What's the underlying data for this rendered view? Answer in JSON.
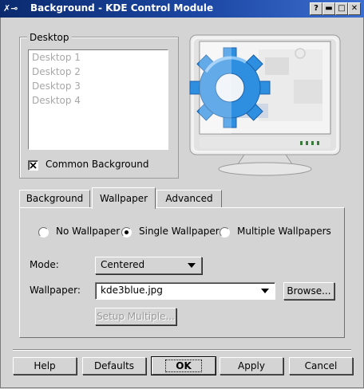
{
  "window": {
    "title": "Background - KDE Control Module",
    "icon_text": "✗⊸",
    "buttons": {
      "help": "?",
      "minimize": "▬",
      "maximize": "□",
      "close": "✕"
    }
  },
  "desktop": {
    "legend": "Desktop",
    "items": [
      "Desktop 1",
      "Desktop 2",
      "Desktop 3",
      "Desktop 4"
    ],
    "common_background": {
      "label": "Common Background",
      "checked": true
    }
  },
  "tabs": [
    {
      "label": "Background"
    },
    {
      "label": "Wallpaper",
      "active": true
    },
    {
      "label": "Advanced"
    }
  ],
  "wallpaper_tab": {
    "options": [
      {
        "label": "No Wallpaper",
        "selected": false
      },
      {
        "label": "Single Wallpaper",
        "selected": true
      },
      {
        "label": "Multiple Wallpapers",
        "selected": false
      }
    ],
    "mode": {
      "label": "Mode:",
      "value": "Centered"
    },
    "wallpaper": {
      "label": "Wallpaper:",
      "value": "kde3blue.jpg",
      "browse": "Browse..."
    },
    "setup_multiple": "Setup Multiple..."
  },
  "footer": {
    "help": "Help",
    "defaults": "Defaults",
    "ok": "OK",
    "apply": "Apply",
    "cancel": "Cancel"
  },
  "colors": {
    "titlebar": "#1c47a3",
    "panel": "#d4d4d4",
    "wallpaper_accent": "#2e8fe0"
  }
}
